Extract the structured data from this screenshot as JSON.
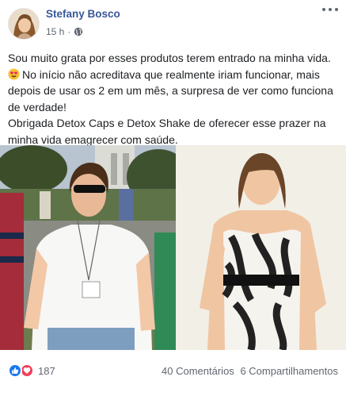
{
  "post": {
    "author": "Stefany Bosco",
    "time": "15 h",
    "separator": "·",
    "privacy_icon": "globe-icon",
    "paragraphs": [
      "Sou muito grata por esses produtos terem entrado na minha vida.",
      "No início não acreditava que realmente iriam funcionar, mais depois de usar os 2 em um mês, a surpresa de ver como funciona de verdade!",
      "Obrigada Detox Caps e Detox Shake de oferecer esse prazer na minha vida emagrecer com saúde."
    ],
    "emoji": "smiling-face-with-heart-eyes"
  },
  "footer": {
    "reaction_count": "187",
    "comments": "40 Comentários",
    "shares": "6 Compartilhamentos"
  },
  "colors": {
    "author": "#385898",
    "meta": "#606770",
    "like": "#1877f2",
    "love": "#f33e58"
  }
}
